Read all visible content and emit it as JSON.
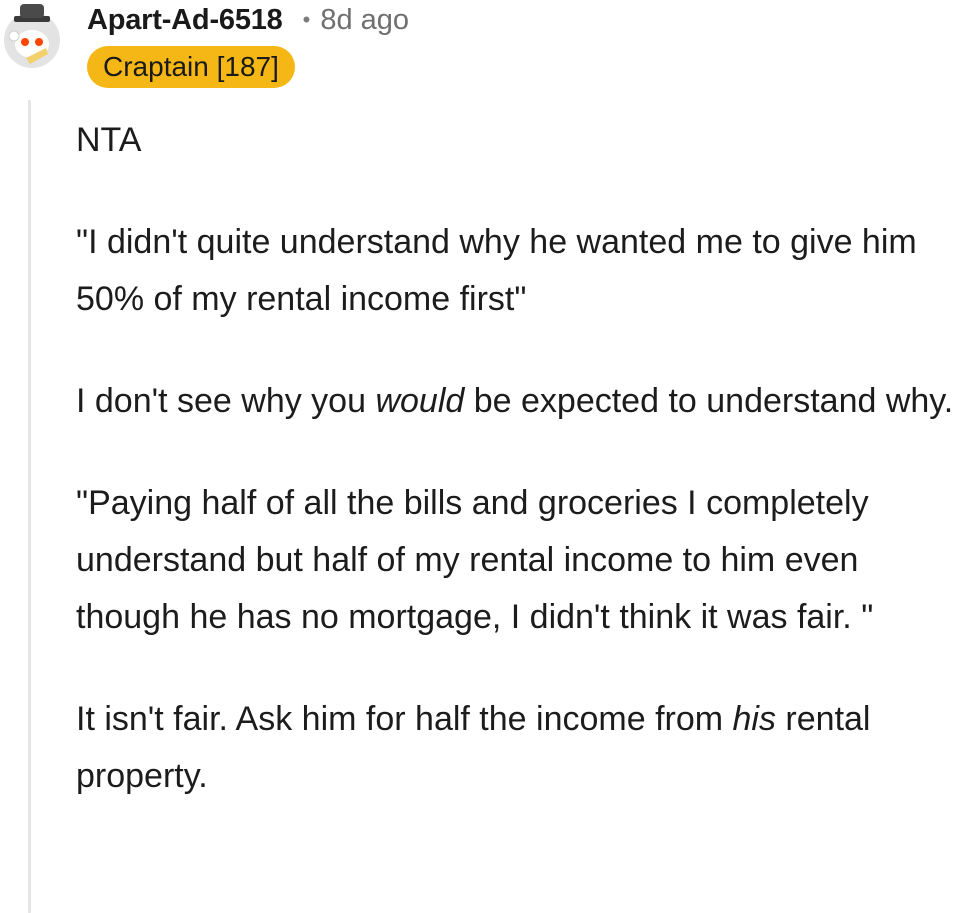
{
  "comment": {
    "author": "Apart-Ad-6518",
    "separator": "•",
    "time": "8d ago",
    "flair": "Craptain [187]",
    "avatar_icon": "snoo-avatar-icon",
    "flair_color": "#f4b715",
    "paragraphs": [
      {
        "text": "NTA"
      },
      {
        "text": "\"I didn't quite understand why he wanted me to give him 50% of my rental income first\""
      },
      {
        "before": "I don't see why you ",
        "emphasis": "would",
        "after": " be expected to understand why."
      },
      {
        "text": "\"Paying half of all the bills and groceries I completely understand but half of my rental income to him even though he has no mortgage, I didn't think it was fair. \""
      },
      {
        "before": "It isn't fair. Ask him for half the income from ",
        "emphasis": "his",
        "after": " rental property."
      }
    ]
  }
}
